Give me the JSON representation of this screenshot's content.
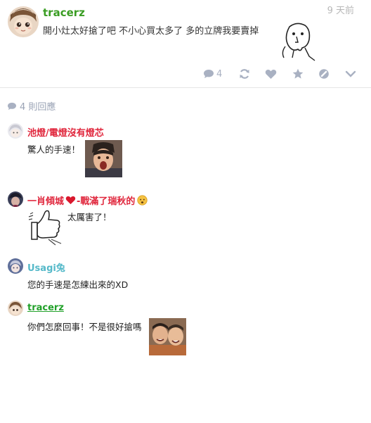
{
  "post": {
    "username": "tracerz",
    "time": "9 天前",
    "text": "開小灶太好搶了吧 不小心買太多了 多的立牌我要賣掉",
    "comment_count": "4"
  },
  "replies_header": "4 則回應",
  "comments": [
    {
      "username": "池燈/電燈沒有燈芯",
      "text": "驚人的手速！"
    },
    {
      "username_a": "一肖傾城",
      "username_b": "-戰滿了瑞秋的",
      "text": "太厲害了！"
    },
    {
      "username": "Usagi兔",
      "text": "您的手速是怎練出來的XD"
    },
    {
      "username": "tracerz",
      "text": "你們怎麼回事！不是很好搶嗎"
    }
  ],
  "colors": {
    "post_user": "#3a9d23",
    "comment_red": "#e0263c",
    "comment_teal": "#55b9c9",
    "comment_green": "#22a12a",
    "icons": "#a9b1c2"
  },
  "icons": [
    "comment-icon",
    "repost-icon",
    "heart-icon",
    "star-icon",
    "block-icon",
    "chevron-down-icon"
  ]
}
